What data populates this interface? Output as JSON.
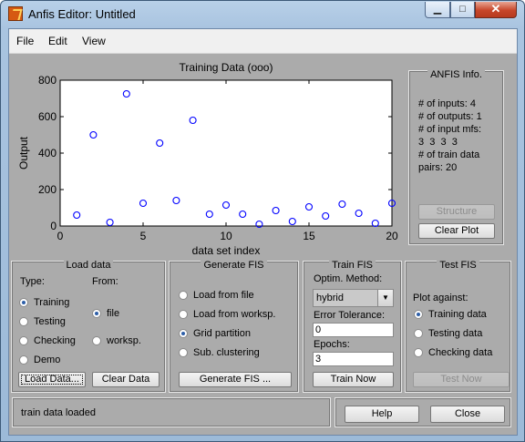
{
  "window": {
    "title": "Anfis Editor: Untitled",
    "minimize": "▁",
    "maximize": "□",
    "close": "✕"
  },
  "menu": [
    "File",
    "Edit",
    "View"
  ],
  "chart_data": {
    "type": "scatter",
    "title": "Training Data (ooo)",
    "xlabel": "data set index",
    "ylabel": "Output",
    "xlim": [
      0,
      20
    ],
    "ylim": [
      0,
      800
    ],
    "xticks": [
      0,
      5,
      10,
      15,
      20
    ],
    "yticks": [
      0,
      200,
      400,
      600,
      800
    ],
    "marker": "circle",
    "marker_color": "#0000ff",
    "grid": false,
    "x": [
      1,
      2,
      3,
      4,
      5,
      6,
      7,
      8,
      9,
      10,
      11,
      12,
      13,
      14,
      15,
      16,
      17,
      18,
      19,
      20
    ],
    "y": [
      60,
      500,
      20,
      725,
      125,
      455,
      140,
      580,
      65,
      115,
      65,
      10,
      85,
      25,
      105,
      55,
      120,
      70,
      15,
      125
    ]
  },
  "anfis_info": {
    "title": "ANFIS Info.",
    "inputs": "# of inputs: 4",
    "outputs": "# of outputs: 1",
    "mfs_label": "# of input mfs:",
    "mfs_values": "3  3  3  3",
    "train_label": "# of train data",
    "train_pairs": "pairs: 20",
    "structure_btn": "Structure",
    "clear_plot_btn": "Clear Plot"
  },
  "load_data": {
    "title": "Load data",
    "type_label": "Type:",
    "from_label": "From:",
    "types": [
      "Training",
      "Testing",
      "Checking",
      "Demo"
    ],
    "sources": [
      "file",
      "worksp."
    ],
    "load_btn": "Load Data...",
    "clear_btn": "Clear Data"
  },
  "generate_fis": {
    "title": "Generate FIS",
    "options": [
      "Load from file",
      "Load from worksp.",
      "Grid partition",
      "Sub. clustering"
    ],
    "generate_btn": "Generate FIS ..."
  },
  "train_fis": {
    "title": "Train FIS",
    "method_label": "Optim. Method:",
    "method_value": "hybrid",
    "tolerance_label": "Error Tolerance:",
    "tolerance_value": "0",
    "epochs_label": "Epochs:",
    "epochs_value": "3",
    "train_btn": "Train Now"
  },
  "test_fis": {
    "title": "Test FIS",
    "plot_against_label": "Plot against:",
    "options": [
      "Training data",
      "Testing data",
      "Checking data"
    ],
    "test_btn": "Test Now"
  },
  "status": {
    "message": "train data loaded"
  },
  "footer": {
    "help_btn": "Help",
    "close_btn": "Close"
  }
}
